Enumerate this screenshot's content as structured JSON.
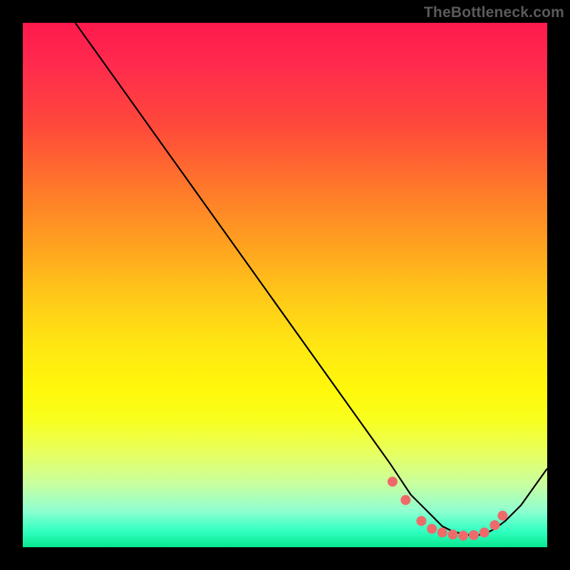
{
  "watermark": "TheBottleneck.com",
  "chart_data": {
    "type": "line",
    "title": "",
    "xlabel": "",
    "ylabel": "",
    "xlim": [
      0,
      100
    ],
    "ylim": [
      0,
      100
    ],
    "series": [
      {
        "name": "bottleneck-curve",
        "x": [
          10,
          15,
          20,
          25,
          30,
          35,
          40,
          45,
          50,
          55,
          60,
          65,
          70,
          72,
          74,
          76,
          78,
          80,
          82,
          84,
          86,
          88,
          90,
          92,
          95,
          100
        ],
        "y": [
          100,
          93,
          86,
          79,
          72,
          65,
          58,
          51,
          44,
          37,
          30,
          23,
          16,
          13,
          10,
          8,
          6,
          4,
          3,
          2.5,
          2.2,
          2.5,
          3.5,
          5,
          8,
          15
        ]
      }
    ],
    "markers": {
      "name": "highlight-dots",
      "x": [
        70.5,
        73,
        76,
        78,
        80,
        82,
        84,
        86,
        88,
        90,
        91.5
      ],
      "y": [
        12.5,
        9,
        5,
        3.5,
        2.8,
        2.4,
        2.2,
        2.3,
        2.8,
        4.2,
        6
      ]
    }
  }
}
